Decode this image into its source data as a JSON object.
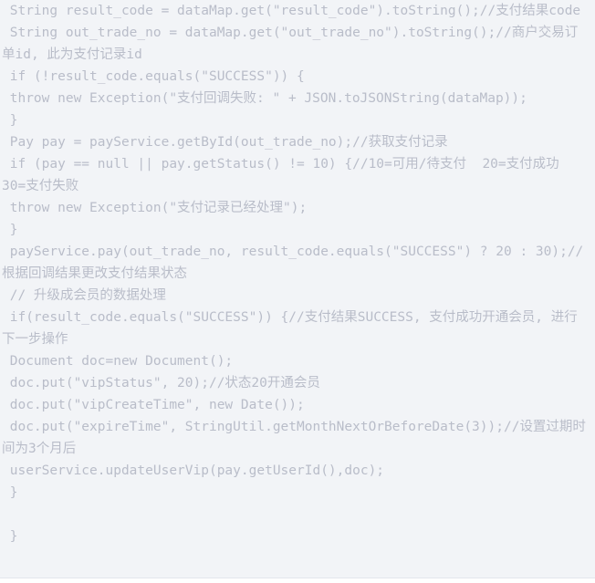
{
  "code_block": {
    "language": "java",
    "background_color": "#f2f4f7",
    "text_color": "#b9bdc9",
    "border_bottom_color": "#e3e6ec",
    "lines": [
      " String result_code = dataMap.get(\"result_code\").toString();//支付结果code",
      " String out_trade_no = dataMap.get(\"out_trade_no\").toString();//商户交易订单id, 此为支付记录id",
      " if (!result_code.equals(\"SUCCESS\")) {",
      " throw new Exception(\"支付回调失败: \" + JSON.toJSONString(dataMap));",
      " }",
      " Pay pay = payService.getById(out_trade_no);//获取支付记录",
      " if (pay == null || pay.getStatus() != 10) {//10=可用/待支付  20=支付成功 30=支付失败",
      " throw new Exception(\"支付记录已经处理\");",
      " }",
      " payService.pay(out_trade_no, result_code.equals(\"SUCCESS\") ? 20 : 30);//根据回调结果更改支付结果状态",
      " // 升级成会员的数据处理",
      " if(result_code.equals(\"SUCCESS\")) {//支付结果SUCCESS, 支付成功开通会员, 进行下一步操作",
      " Document doc=new Document();",
      " doc.put(\"vipStatus\", 20);//状态20开通会员",
      " doc.put(\"vipCreateTime\", new Date());",
      " doc.put(\"expireTime\", StringUtil.getMonthNextOrBeforeDate(3));//设置过期时间为3个月后",
      " userService.updateUserVip(pay.getUserId(),doc);",
      " }",
      "",
      " }"
    ]
  }
}
